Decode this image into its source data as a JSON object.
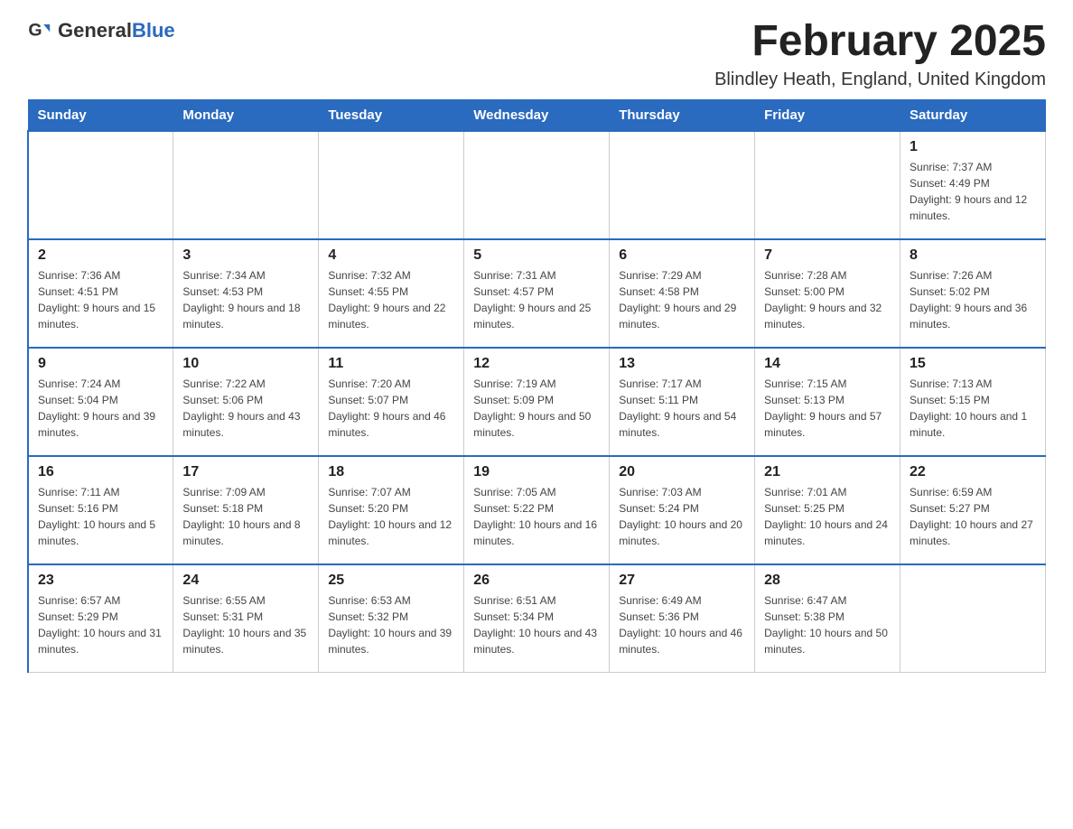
{
  "header": {
    "logo": {
      "text_general": "General",
      "text_blue": "Blue",
      "logo_alt": "GeneralBlue logo"
    },
    "title": "February 2025",
    "location": "Blindley Heath, England, United Kingdom"
  },
  "days_of_week": [
    "Sunday",
    "Monday",
    "Tuesday",
    "Wednesday",
    "Thursday",
    "Friday",
    "Saturday"
  ],
  "weeks": [
    [
      {
        "day": "",
        "info": ""
      },
      {
        "day": "",
        "info": ""
      },
      {
        "day": "",
        "info": ""
      },
      {
        "day": "",
        "info": ""
      },
      {
        "day": "",
        "info": ""
      },
      {
        "day": "",
        "info": ""
      },
      {
        "day": "1",
        "info": "Sunrise: 7:37 AM\nSunset: 4:49 PM\nDaylight: 9 hours and 12 minutes."
      }
    ],
    [
      {
        "day": "2",
        "info": "Sunrise: 7:36 AM\nSunset: 4:51 PM\nDaylight: 9 hours and 15 minutes."
      },
      {
        "day": "3",
        "info": "Sunrise: 7:34 AM\nSunset: 4:53 PM\nDaylight: 9 hours and 18 minutes."
      },
      {
        "day": "4",
        "info": "Sunrise: 7:32 AM\nSunset: 4:55 PM\nDaylight: 9 hours and 22 minutes."
      },
      {
        "day": "5",
        "info": "Sunrise: 7:31 AM\nSunset: 4:57 PM\nDaylight: 9 hours and 25 minutes."
      },
      {
        "day": "6",
        "info": "Sunrise: 7:29 AM\nSunset: 4:58 PM\nDaylight: 9 hours and 29 minutes."
      },
      {
        "day": "7",
        "info": "Sunrise: 7:28 AM\nSunset: 5:00 PM\nDaylight: 9 hours and 32 minutes."
      },
      {
        "day": "8",
        "info": "Sunrise: 7:26 AM\nSunset: 5:02 PM\nDaylight: 9 hours and 36 minutes."
      }
    ],
    [
      {
        "day": "9",
        "info": "Sunrise: 7:24 AM\nSunset: 5:04 PM\nDaylight: 9 hours and 39 minutes."
      },
      {
        "day": "10",
        "info": "Sunrise: 7:22 AM\nSunset: 5:06 PM\nDaylight: 9 hours and 43 minutes."
      },
      {
        "day": "11",
        "info": "Sunrise: 7:20 AM\nSunset: 5:07 PM\nDaylight: 9 hours and 46 minutes."
      },
      {
        "day": "12",
        "info": "Sunrise: 7:19 AM\nSunset: 5:09 PM\nDaylight: 9 hours and 50 minutes."
      },
      {
        "day": "13",
        "info": "Sunrise: 7:17 AM\nSunset: 5:11 PM\nDaylight: 9 hours and 54 minutes."
      },
      {
        "day": "14",
        "info": "Sunrise: 7:15 AM\nSunset: 5:13 PM\nDaylight: 9 hours and 57 minutes."
      },
      {
        "day": "15",
        "info": "Sunrise: 7:13 AM\nSunset: 5:15 PM\nDaylight: 10 hours and 1 minute."
      }
    ],
    [
      {
        "day": "16",
        "info": "Sunrise: 7:11 AM\nSunset: 5:16 PM\nDaylight: 10 hours and 5 minutes."
      },
      {
        "day": "17",
        "info": "Sunrise: 7:09 AM\nSunset: 5:18 PM\nDaylight: 10 hours and 8 minutes."
      },
      {
        "day": "18",
        "info": "Sunrise: 7:07 AM\nSunset: 5:20 PM\nDaylight: 10 hours and 12 minutes."
      },
      {
        "day": "19",
        "info": "Sunrise: 7:05 AM\nSunset: 5:22 PM\nDaylight: 10 hours and 16 minutes."
      },
      {
        "day": "20",
        "info": "Sunrise: 7:03 AM\nSunset: 5:24 PM\nDaylight: 10 hours and 20 minutes."
      },
      {
        "day": "21",
        "info": "Sunrise: 7:01 AM\nSunset: 5:25 PM\nDaylight: 10 hours and 24 minutes."
      },
      {
        "day": "22",
        "info": "Sunrise: 6:59 AM\nSunset: 5:27 PM\nDaylight: 10 hours and 27 minutes."
      }
    ],
    [
      {
        "day": "23",
        "info": "Sunrise: 6:57 AM\nSunset: 5:29 PM\nDaylight: 10 hours and 31 minutes."
      },
      {
        "day": "24",
        "info": "Sunrise: 6:55 AM\nSunset: 5:31 PM\nDaylight: 10 hours and 35 minutes."
      },
      {
        "day": "25",
        "info": "Sunrise: 6:53 AM\nSunset: 5:32 PM\nDaylight: 10 hours and 39 minutes."
      },
      {
        "day": "26",
        "info": "Sunrise: 6:51 AM\nSunset: 5:34 PM\nDaylight: 10 hours and 43 minutes."
      },
      {
        "day": "27",
        "info": "Sunrise: 6:49 AM\nSunset: 5:36 PM\nDaylight: 10 hours and 46 minutes."
      },
      {
        "day": "28",
        "info": "Sunrise: 6:47 AM\nSunset: 5:38 PM\nDaylight: 10 hours and 50 minutes."
      },
      {
        "day": "",
        "info": ""
      }
    ]
  ]
}
